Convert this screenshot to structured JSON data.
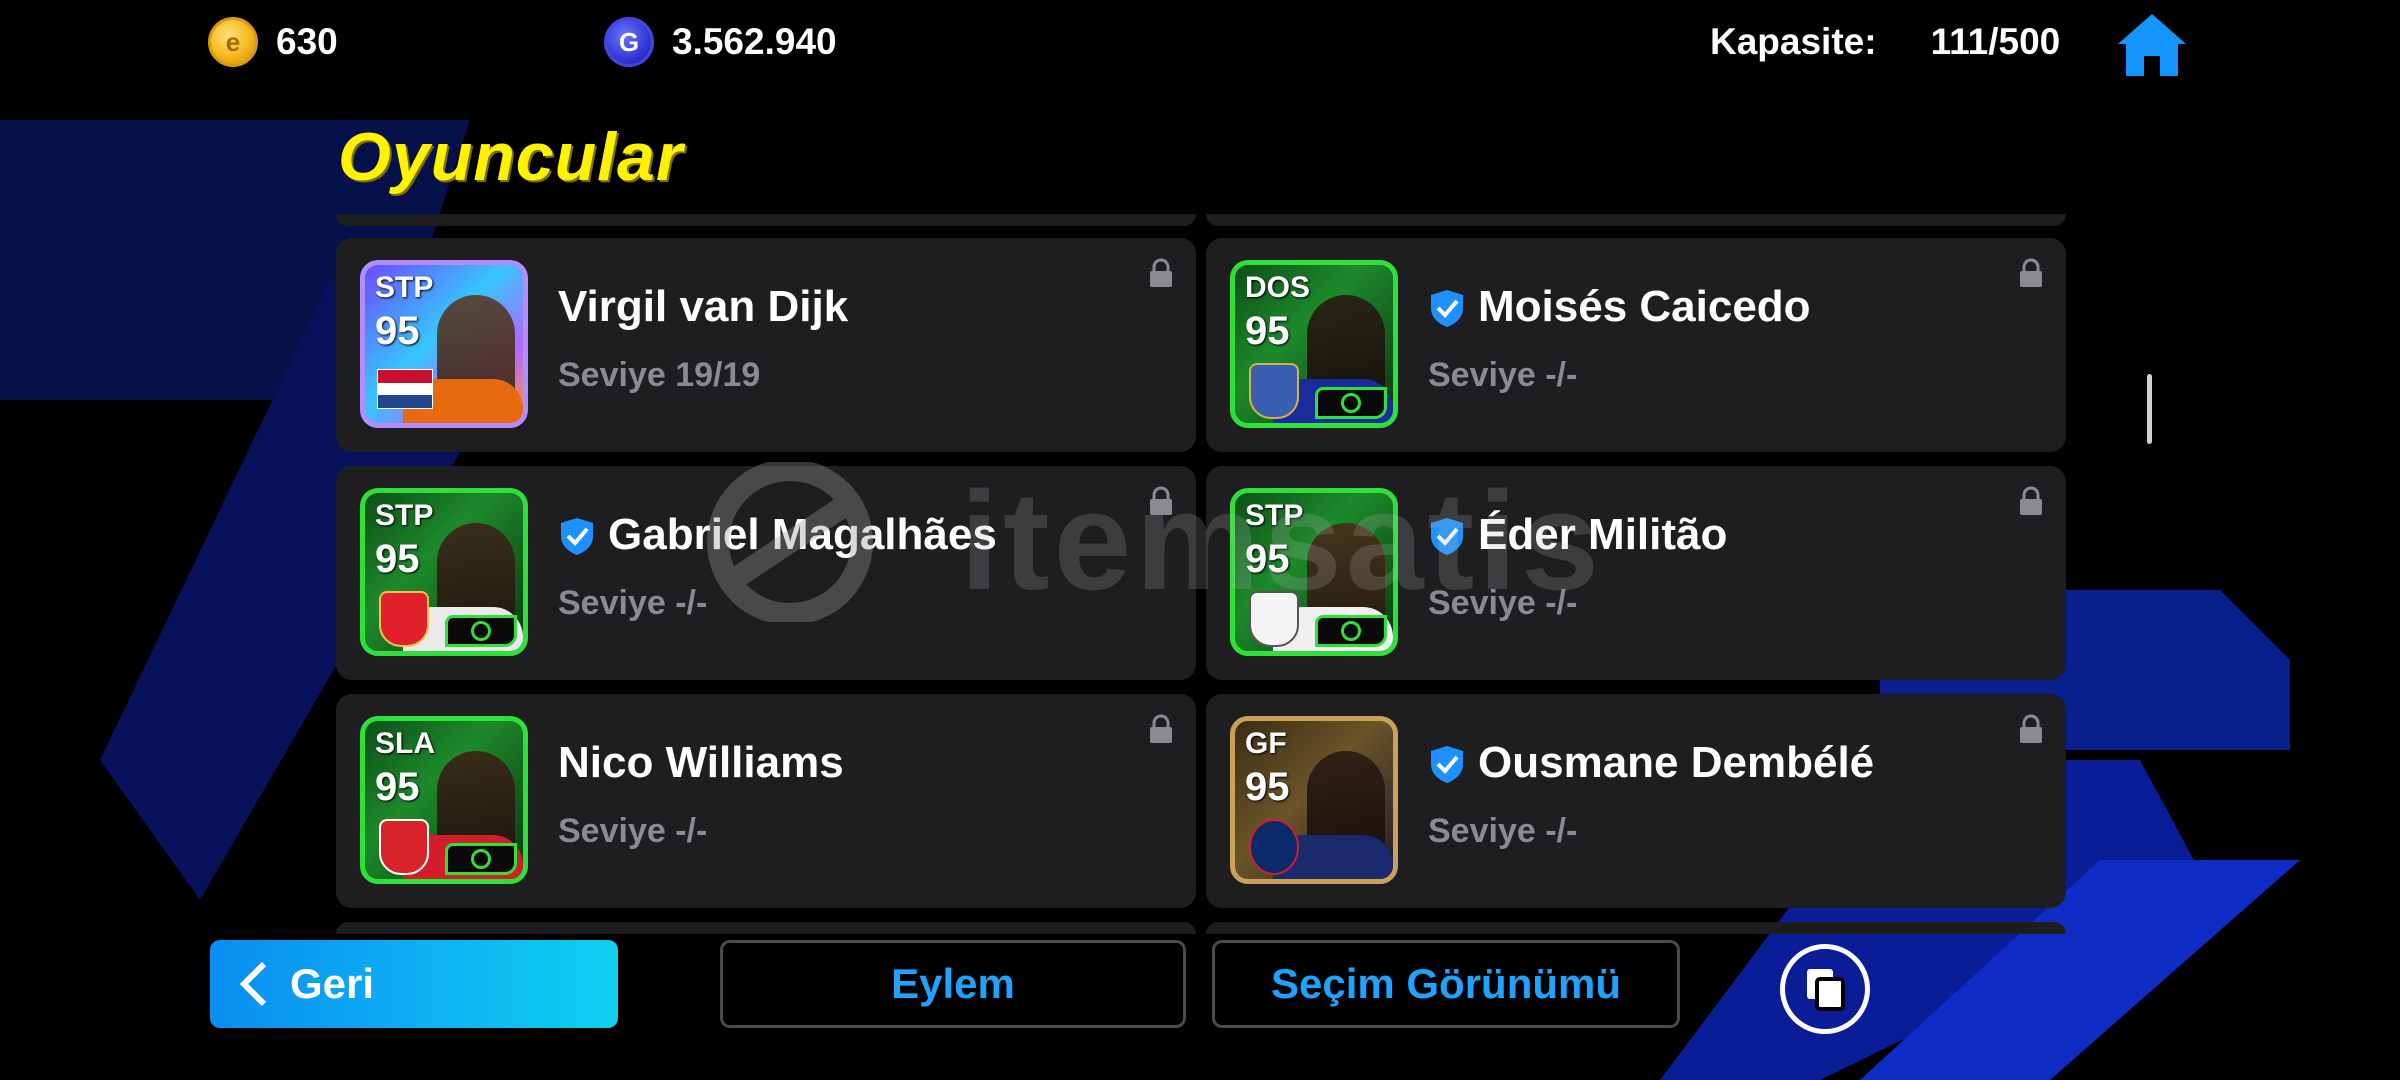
{
  "currency": {
    "coins": "630",
    "gp": "3.562.940"
  },
  "capacity": {
    "label": "Kapasite:",
    "value": "111/500"
  },
  "page": {
    "title": "Oyuncular"
  },
  "players": [
    {
      "position": "STP",
      "rating": "95",
      "name": "Virgil van Dijk",
      "level": "Seviye 19/19",
      "verified": false,
      "frame": "purple"
    },
    {
      "position": "DOS",
      "rating": "95",
      "name": "Moisés Caicedo",
      "level": "Seviye -/-",
      "verified": true,
      "frame": "green"
    },
    {
      "position": "STP",
      "rating": "95",
      "name": "Gabriel Magalhães",
      "level": "Seviye -/-",
      "verified": true,
      "frame": "green"
    },
    {
      "position": "STP",
      "rating": "95",
      "name": "Éder Militão",
      "level": "Seviye -/-",
      "verified": true,
      "frame": "green"
    },
    {
      "position": "SLA",
      "rating": "95",
      "name": "Nico Williams",
      "level": "Seviye -/-",
      "verified": false,
      "frame": "green"
    },
    {
      "position": "GF",
      "rating": "95",
      "name": "Ousmane Dembélé",
      "level": "Seviye -/-",
      "verified": true,
      "frame": "gold"
    }
  ],
  "watermark": "itemsatis",
  "buttons": {
    "back": "Geri",
    "action": "Eylem",
    "selection_view": "Seçim Görünümü"
  },
  "icons": {
    "coin": "coin-icon",
    "gp": "gp-icon",
    "home": "home-icon",
    "lock": "lock-icon",
    "verified": "verified-shield-icon",
    "back": "chevron-left-icon",
    "copy": "copy-icon"
  },
  "colors": {
    "title": "#fff200",
    "accent_blue": "#1fa3ff",
    "frame_green": "#2fe03a",
    "verified_blue": "#1e90ff"
  }
}
